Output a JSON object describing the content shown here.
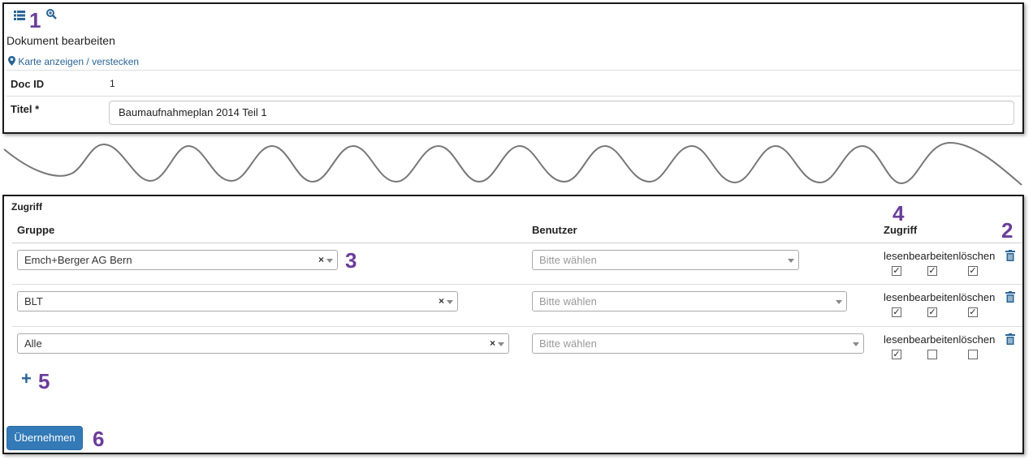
{
  "top": {
    "callout_1": "1",
    "title": "Dokument bearbeiten",
    "map_toggle": "Karte anzeigen / verstecken",
    "doc_id_label": "Doc ID",
    "doc_id_value": "1",
    "title_label": "Titel *",
    "title_value": "Baumaufnahmeplan 2014 Teil 1"
  },
  "access": {
    "section_title": "Zugriff",
    "columns": {
      "group": "Gruppe",
      "user": "Benutzer",
      "access": "Zugriff"
    },
    "callouts": {
      "c2": "2",
      "c3": "3",
      "c4": "4",
      "c5": "5",
      "c6": "6"
    },
    "rows": [
      {
        "group": "Emch+Berger AG Bern",
        "user_placeholder": "Bitte wählen",
        "labels": "lesenbearbeitenlöschen",
        "read": true,
        "edit": true,
        "delete": true
      },
      {
        "group": "BLT",
        "user_placeholder": "Bitte wählen",
        "labels": "lesenbearbeitenlöschen",
        "read": true,
        "edit": true,
        "delete": true
      },
      {
        "group": "Alle",
        "user_placeholder": "Bitte wählen",
        "labels": "lesenbearbeitenlöschen",
        "read": true,
        "edit": false,
        "delete": false
      }
    ],
    "clear_symbol": "×",
    "add_symbol": "+",
    "submit_label": "Übernehmen"
  },
  "colors": {
    "accent": "#337ab7",
    "link": "#2a6496",
    "callout": "#6a3d9a"
  }
}
